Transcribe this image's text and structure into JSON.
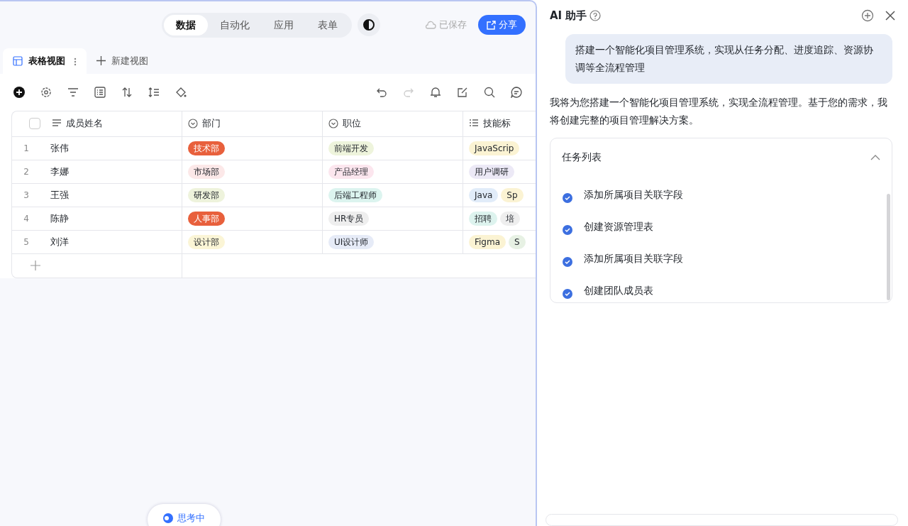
{
  "top_tabs": [
    {
      "label": "数据",
      "selected": true
    },
    {
      "label": "自动化",
      "selected": false
    },
    {
      "label": "应用",
      "selected": false
    },
    {
      "label": "表单",
      "selected": false
    }
  ],
  "save_status": "已保存",
  "share_button": "分享",
  "view_tabs": [
    {
      "label": "表格视图",
      "selected": true
    },
    {
      "label": "新建视图",
      "selected": false
    }
  ],
  "table": {
    "select_all_checked": false,
    "columns": [
      {
        "label": "成员姓名",
        "kind": "text"
      },
      {
        "label": "部门",
        "kind": "select"
      },
      {
        "label": "职位",
        "kind": "select"
      },
      {
        "label": "技能标",
        "kind": "multi"
      }
    ],
    "rows": [
      {
        "index": "1",
        "name": "张伟",
        "department": {
          "text": "技术部",
          "color": "#e8603c"
        },
        "position": {
          "text": "前端开发",
          "color": "#eef4dc"
        },
        "skills": [
          {
            "text": "JavaScrip",
            "color": "#fbf3d3"
          }
        ]
      },
      {
        "index": "2",
        "name": "李娜",
        "department": {
          "text": "市场部",
          "color": "#fce8e8"
        },
        "position": {
          "text": "产品经理",
          "color": "#fce6ee"
        },
        "skills": [
          {
            "text": "用户调研",
            "color": "#ece9f6"
          }
        ]
      },
      {
        "index": "3",
        "name": "王强",
        "department": {
          "text": "研发部",
          "color": "#eef3dc"
        },
        "position": {
          "text": "后端工程师",
          "color": "#dcf4ef"
        },
        "skills": [
          {
            "text": "Java",
            "color": "#e1ecf9"
          },
          {
            "text": "Sp",
            "color": "#fbf3d3"
          }
        ]
      },
      {
        "index": "4",
        "name": "陈静",
        "department": {
          "text": "人事部",
          "color": "#e8603c"
        },
        "position": {
          "text": "HR专员",
          "color": "#eeeeee"
        },
        "skills": [
          {
            "text": "招聘",
            "color": "#ddf3ee"
          },
          {
            "text": "培",
            "color": "#eeeeee"
          }
        ]
      },
      {
        "index": "5",
        "name": "刘洋",
        "department": {
          "text": "设计部",
          "color": "#fbf5d6"
        },
        "position": {
          "text": "UI设计师",
          "color": "#e6ebf7"
        },
        "skills": [
          {
            "text": "Figma",
            "color": "#fbf3d3"
          },
          {
            "text": "S",
            "color": "#e7f1e4"
          }
        ]
      }
    ]
  },
  "thinking_label": "思考中",
  "assistant": {
    "title": "AI 助手",
    "user_message": "搭建一个智能化项目管理系统，实现从任务分配、进度追踪、资源协调等全流程管理",
    "reply": "我将为您搭建一个智能化项目管理系统，实现全流程管理。基于您的需求，我将创建完整的项目管理解决方案。",
    "task_card": {
      "title": "任务列表",
      "expanded": true,
      "tasks": [
        {
          "label": "添加所属项目关联字段",
          "checked": true
        },
        {
          "label": "创建资源管理表",
          "checked": true
        },
        {
          "label": "添加所属项目关联字段",
          "checked": true
        },
        {
          "label": "创建团队成员表",
          "checked": true
        }
      ]
    }
  }
}
